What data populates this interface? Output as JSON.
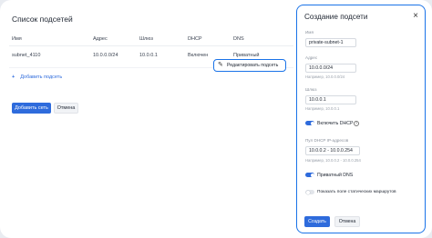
{
  "list": {
    "title": "Список подсетей",
    "columns": [
      "Имя",
      "Адрес",
      "Шлюз",
      "DHCP",
      "DNS"
    ],
    "rows": [
      {
        "name": "subnet_4110",
        "address": "10.0.0.0/24",
        "gateway": "10.0.0.1",
        "dhcp": "Включен",
        "dns": "Приватный"
      }
    ],
    "add_subnet": "Добавить подсеть",
    "add_subnet_icon": "plus-icon"
  },
  "row_menu": {
    "edit_label": "Редактировать подсеть",
    "edit_icon": "pencil-icon"
  },
  "actions": {
    "add_network": "Добавить сеть",
    "cancel": "Отмена"
  },
  "dialog": {
    "title": "Создание подсети",
    "close_icon": "close-icon",
    "name_label": "Имя",
    "name_value": "private-subnet-1",
    "address_label": "Адрес",
    "address_value": "10.0.0.0/24",
    "address_hint": "Например, 10.0.0.0/24",
    "gateway_label": "Шлюз",
    "gateway_value": "10.0.0.1",
    "gateway_hint": "Например, 10.0.0.1",
    "dhcp_toggle_label": "Включить DHCP",
    "dhcp_on": true,
    "pool_label": "Пул DHCP IP-адресов",
    "pool_value": "10.0.0.2 - 10.0.0.254",
    "pool_hint": "Например, 10.0.0.2 - 10.0.0.254",
    "private_dns_label": "Приватный DNS",
    "private_dns_on": true,
    "static_routes_label": "Показать поле статических маршрутов",
    "static_routes_on": false,
    "create": "Создать",
    "cancel": "Отмена"
  },
  "colors": {
    "accent": "#2e6bdc",
    "focus_outline": "#1a73e8"
  }
}
